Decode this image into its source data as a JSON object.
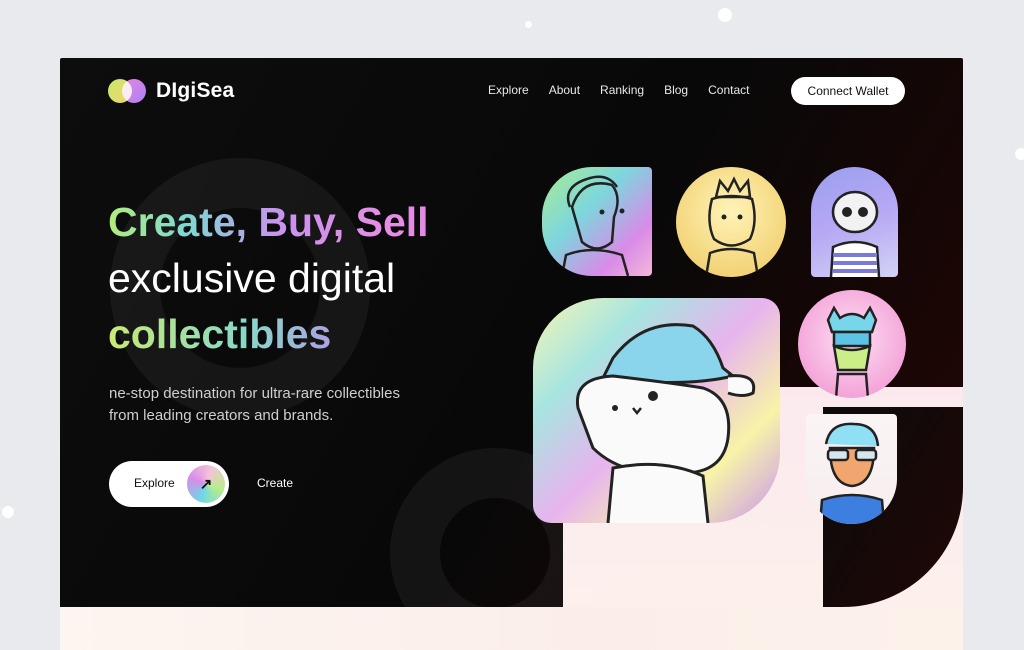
{
  "brand": {
    "name": "DIgiSea"
  },
  "nav": {
    "items": [
      "Explore",
      "About",
      "Ranking",
      "Blog",
      "Contact"
    ],
    "connect_label": "Connect Wallet"
  },
  "hero": {
    "headline_line1": "Create, Buy, Sell",
    "headline_line2": "exclusive digital",
    "headline_line3": "collectibles",
    "subtitle_line1": "ne-stop destination for ultra-rare collectibles",
    "subtitle_line2": "from leading creators and brands.",
    "explore_label": "Explore",
    "create_label": "Create"
  },
  "nfts": [
    {
      "icon": "rainbow-person-icon"
    },
    {
      "icon": "king-monkey-icon"
    },
    {
      "icon": "skull-character-icon"
    },
    {
      "icon": "bucket-hat-cat-icon"
    },
    {
      "icon": "viking-character-icon"
    },
    {
      "icon": "sunglasses-boy-icon"
    }
  ],
  "colors": {
    "card_bg": "#0d0d0d",
    "accent_green": "#b4ec7b",
    "accent_pink": "#e083e8",
    "accent_purple": "#b88bf0"
  }
}
